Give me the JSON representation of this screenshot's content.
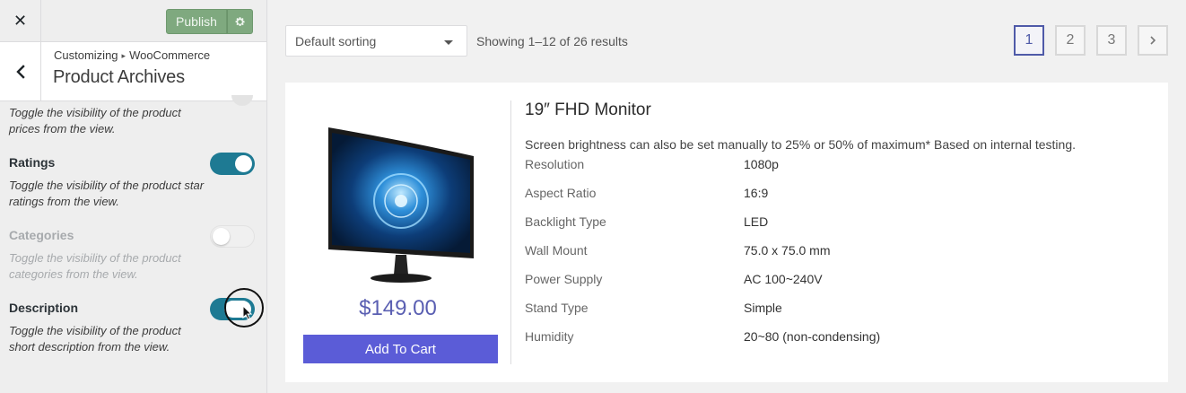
{
  "topbar": {
    "close_label": "✕",
    "publish_label": "Publish",
    "settings_icon": "gear-icon"
  },
  "header": {
    "breadcrumb_root": "Customizing",
    "breadcrumb_separator": "▸",
    "breadcrumb_section": "WooCommerce",
    "title": "Product Archives"
  },
  "options": {
    "prices_description": "Toggle the visibility of the product prices from the view.",
    "ratings": {
      "label": "Ratings",
      "description": "Toggle the visibility of the product star ratings from the view.",
      "enabled": true
    },
    "categories": {
      "label": "Categories",
      "description": "Toggle the visibility of the product categories from the view.",
      "enabled": false
    },
    "description": {
      "label": "Description",
      "description": "Toggle the visibility of the product short description from the view.",
      "enabled": true
    }
  },
  "toolbar": {
    "sorting_value": "Default sorting",
    "results_text": "Showing 1–12 of 26 results",
    "pages": [
      "1",
      "2",
      "3"
    ],
    "active_page": "1",
    "next_label": "›"
  },
  "product": {
    "title": "19″ FHD Monitor",
    "description": "Screen brightness can also be set manually to 25% or 50% of maximum* Based on internal testing.",
    "price": "$149.00",
    "add_to_cart": "Add To Cart",
    "specs": [
      {
        "key": "Resolution",
        "value": "1080p"
      },
      {
        "key": "Aspect Ratio",
        "value": "16:9"
      },
      {
        "key": "Backlight Type",
        "value": "LED"
      },
      {
        "key": "Wall Mount",
        "value": "75.0 x 75.0 mm"
      },
      {
        "key": "Power Supply",
        "value": "AC 100~240V"
      },
      {
        "key": "Stand Type",
        "value": "Simple"
      },
      {
        "key": "Humidity",
        "value": "20~80 (non-condensing)"
      }
    ]
  },
  "colors": {
    "accent": "#5b5cd7",
    "price": "#5a5fb2",
    "toggle_on": "#1e7a93",
    "publish": "#7fa97f"
  }
}
